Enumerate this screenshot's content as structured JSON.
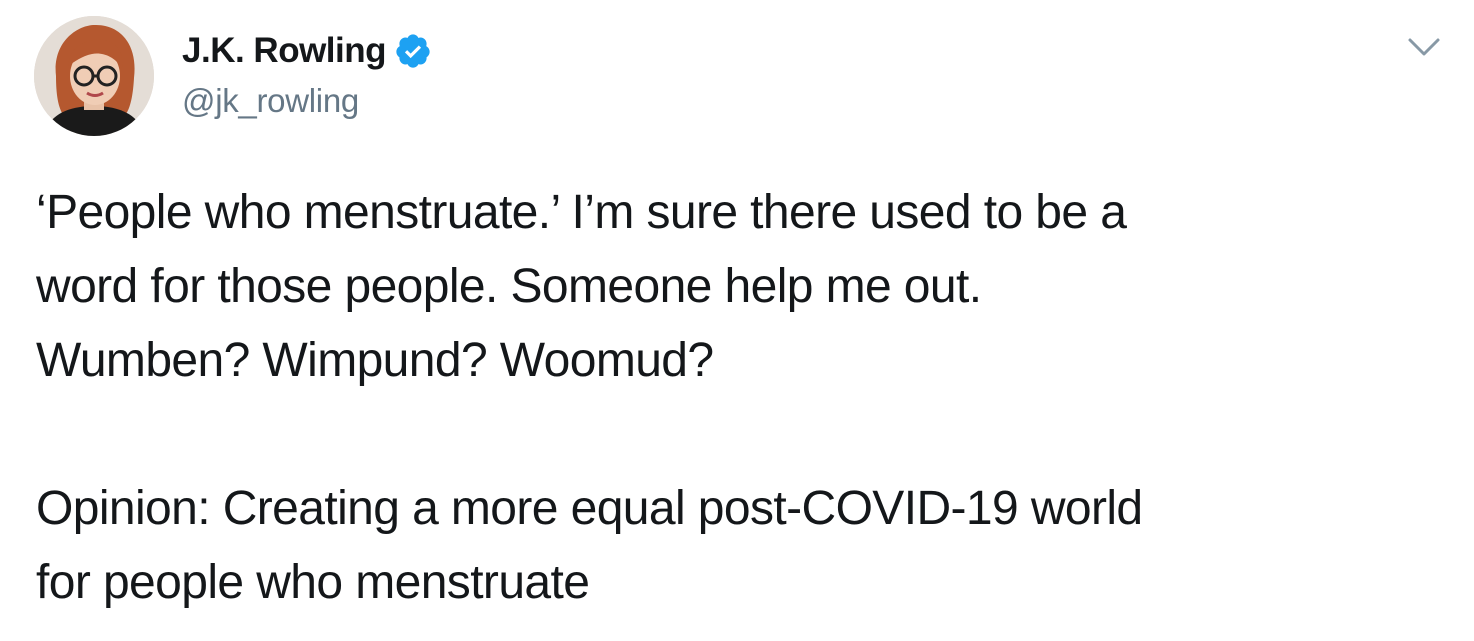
{
  "author": {
    "display_name": "J.K. Rowling",
    "handle": "@jk_rowling",
    "verified": true,
    "verified_badge_color": "#1da1f2"
  },
  "tweet": {
    "lines": [
      "‘People who menstruate.’ I’m sure there used to be a",
      "word for those people. Someone help me out.",
      "Wumben? Wimpund? Woomud?",
      "",
      "Opinion: Creating a more equal post-COVID-19 world",
      "for people who menstruate"
    ]
  },
  "icons": {
    "avatar": "profile-photo",
    "verified": "verified-badge-icon",
    "menu": "chevron-down-icon"
  },
  "colors": {
    "text": "#14171a",
    "secondary": "#657786",
    "chevron": "#8899a6",
    "background": "#ffffff"
  }
}
